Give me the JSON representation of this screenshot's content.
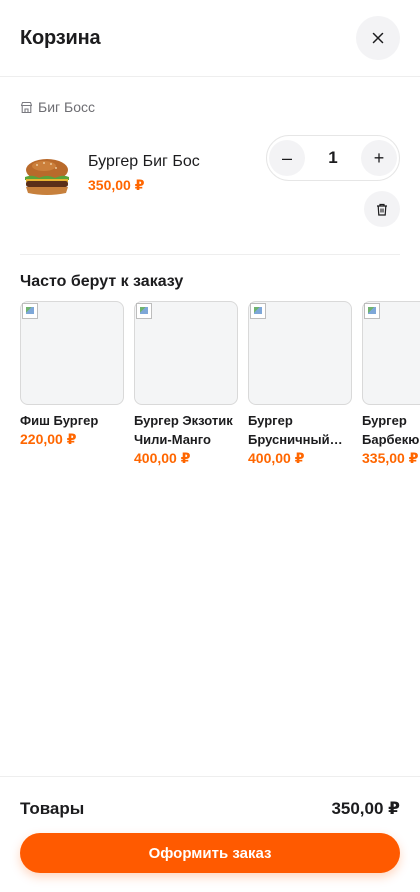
{
  "header": {
    "title": "Корзина",
    "close_icon": "close-icon"
  },
  "store": {
    "name": "Биг Босс",
    "icon": "store-icon"
  },
  "cart": {
    "items": [
      {
        "name": "Бургер Биг Бос",
        "price": "350,00 ₽",
        "quantity": "1",
        "decrement": "–",
        "increment": "+"
      }
    ]
  },
  "suggestions": {
    "title": "Часто берут к заказу",
    "items": [
      {
        "name": "Фиш Бургер",
        "price": "220,00 ₽"
      },
      {
        "name": "Бургер Экзотик Чили-Манго",
        "price": "400,00 ₽"
      },
      {
        "name": "Бургер Брусничный Бекон",
        "price": "400,00 ₽"
      },
      {
        "name": "Бургер Барбекю",
        "price": "335,00 ₽"
      }
    ]
  },
  "summary": {
    "label": "Товары",
    "total": "350,00 ₽"
  },
  "checkout": {
    "label": "Оформить заказ"
  },
  "colors": {
    "accent": "#ff5a00",
    "price": "#ff6600",
    "button_bg": "#f3f3f5"
  }
}
